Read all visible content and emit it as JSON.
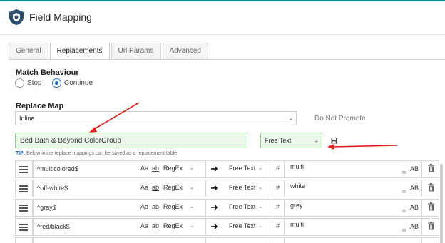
{
  "window": {
    "title": "Field Mapping",
    "logo_icon": "shield-logo-icon"
  },
  "tabs": [
    {
      "label": "General",
      "active": false
    },
    {
      "label": "Replacements",
      "active": true
    },
    {
      "label": "Url Params",
      "active": false
    },
    {
      "label": "Advanced",
      "active": false
    }
  ],
  "match_behaviour": {
    "title": "Match Behaviour",
    "options": [
      {
        "label": "Stop",
        "checked": false
      },
      {
        "label": "Continue",
        "checked": true
      }
    ]
  },
  "replace_map": {
    "title": "Replace Map",
    "source_value": "Inline",
    "promote_text": "Do Not Promote",
    "name_value": "Bed Bath & Beyond ColorGroup",
    "type_value": "Free Text",
    "tip_label": "TIP:",
    "tip_text": " Below inline replace mappings can be saved as a replacement table"
  },
  "rows": [
    {
      "pattern": "^multicolored$",
      "aa": "Aa",
      "ab": "ab",
      "mode": "RegEx",
      "type": "Free Text",
      "hash": "#",
      "value": "multi",
      "ab_btn": "AB"
    },
    {
      "pattern": "^off-white$",
      "aa": "Aa",
      "ab": "ab",
      "mode": "RegEx",
      "type": "Free Text",
      "hash": "#",
      "value": "white",
      "ab_btn": "AB"
    },
    {
      "pattern": "^gray$",
      "aa": "Aa",
      "ab": "ab",
      "mode": "RegEx",
      "type": "Free Text",
      "hash": "#",
      "value": "grey",
      "ab_btn": "AB"
    },
    {
      "pattern": "^red/black$",
      "aa": "Aa",
      "ab": "ab",
      "mode": "RegEx",
      "type": "Free Text",
      "hash": "#",
      "value": "multi",
      "ab_btn": "AB"
    }
  ],
  "colors": {
    "accent": "#1d6fd1",
    "success_bg": "#eaf7ea",
    "annotation": "#e0211b"
  }
}
